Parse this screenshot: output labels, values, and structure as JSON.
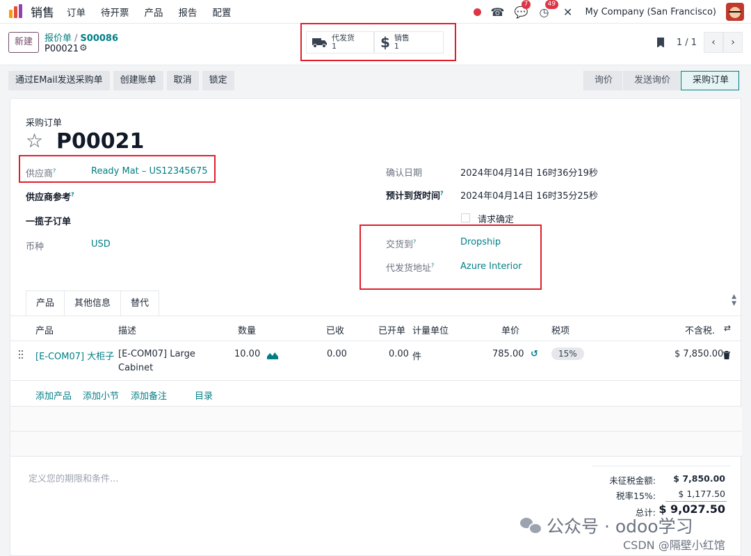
{
  "nav": {
    "app_name": "销售",
    "menu": [
      "订单",
      "待开票",
      "产品",
      "报告",
      "配置"
    ],
    "chat_badge": "7",
    "activity_badge": "49",
    "company": "My Company (San Francisco)"
  },
  "control_panel": {
    "new_label": "新建",
    "breadcrumb_parent": "报价单",
    "breadcrumb_sep": "/",
    "breadcrumb_current": "S00086",
    "record_name": "P00021",
    "smart_buttons": [
      {
        "label": "代发货",
        "count": "1",
        "icon": "truck-icon"
      },
      {
        "label": "销售",
        "count": "1",
        "icon": "dollar-icon"
      }
    ],
    "pager": "1 / 1"
  },
  "actions": [
    "通过EMail发送采购单",
    "创建账单",
    "取消",
    "锁定"
  ],
  "statusbar": [
    "询价",
    "发送询价",
    "采购订单"
  ],
  "form": {
    "type_label": "采购订单",
    "title": "P00021",
    "vendor_label": "供应商",
    "vendor_value": "Ready Mat – US12345675",
    "vendor_ref_label": "供应商参考",
    "blanket_label": "一揽子订单",
    "currency_label": "币种",
    "currency_value": "USD",
    "confirm_date_label": "确认日期",
    "confirm_date_value": "2024年04月14日 16时36分19秒",
    "expected_label": "预计到货时间",
    "expected_value": "2024年04月14日 16时35分25秒",
    "request_confirm_label": "请求确定",
    "deliver_to_label": "交货到",
    "deliver_to_value": "Dropship",
    "dropship_addr_label": "代发货地址",
    "dropship_addr_value": "Azure Interior",
    "help_mark": "?"
  },
  "tabs": [
    "产品",
    "其他信息",
    "替代"
  ],
  "table": {
    "headers": [
      "产品",
      "描述",
      "数量",
      "已收",
      "已开单",
      "计量单位",
      "单价",
      "税项",
      "不含税."
    ],
    "row": {
      "product": "[E-COM07] 大柜子",
      "desc_line1": "[E-COM07] Large",
      "desc_line2": "Cabinet",
      "qty": "10.00",
      "received": "0.00",
      "billed": "0.00",
      "uom": "件",
      "price": "785.00",
      "tax": "15%",
      "subtotal": "$ 7,850.00"
    },
    "add_links": [
      "添加产品",
      "添加小节",
      "添加备注",
      "目录"
    ]
  },
  "terms_placeholder": "定义您的期限和条件...",
  "totals": {
    "untaxed_label": "未征税金额:",
    "untaxed_value": "$ 7,850.00",
    "tax_label": "税率15%:",
    "tax_value": "$ 1,177.50",
    "total_label": "总计:",
    "total_value": "$ 9,027.50"
  },
  "watermark": {
    "text": "公众号 · odoo学习",
    "csdn": "CSDN @隔壁小红馆"
  },
  "colors": {
    "link": "#017e84",
    "brand": "#714b67",
    "annotation_red": "#e11d2a"
  }
}
